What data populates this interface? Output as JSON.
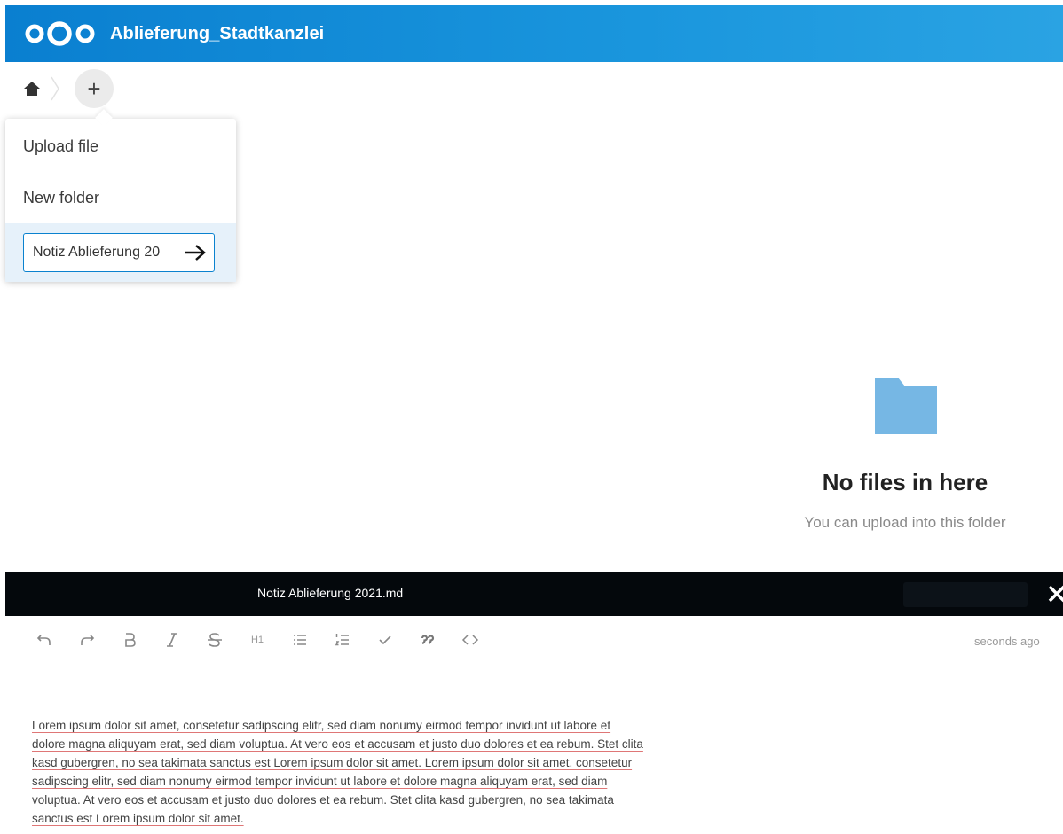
{
  "header": {
    "app_title": "Ablieferung_Stadtkanzlei",
    "accent": "#0082C9"
  },
  "breadcrumbs": {
    "home_icon": "home-icon",
    "new_button_label": "+"
  },
  "new_menu": {
    "items": [
      {
        "label": "Upload file"
      },
      {
        "label": "New folder"
      }
    ],
    "new_file_input_value": "Notiz Ablieferung 20"
  },
  "empty_state": {
    "title": "No files in here",
    "subtitle": "You can upload into this folder"
  },
  "viewer": {
    "file_title": "Notiz Ablieferung 2021.md",
    "close_label": "×"
  },
  "editor": {
    "toolbar": [
      "undo-icon",
      "redo-icon",
      "bold-icon",
      "italic-icon",
      "strikethrough-icon",
      "heading-icon",
      "bullet-list-icon",
      "ordered-list-icon",
      "checklist-icon",
      "quote-icon",
      "code-icon"
    ],
    "heading_label": "H1",
    "saved_status": "seconds ago",
    "content": "Lorem ipsum dolor sit amet, consetetur sadipscing elitr, sed diam nonumy eirmod tempor invidunt ut labore et dolore magna aliquyam erat, sed diam voluptua. At vero eos et accusam et justo duo dolores et ea rebum. Stet clita kasd gubergren, no sea takimata sanctus est Lorem ipsum dolor sit amet. Lorem ipsum dolor sit amet, consetetur sadipscing elitr, sed diam nonumy eirmod tempor invidunt ut labore et dolore magna aliquyam erat, sed diam voluptua. At vero eos et accusam et justo duo dolores et ea rebum. Stet clita kasd gubergren, no sea takimata sanctus est Lorem ipsum dolor sit amet."
  }
}
